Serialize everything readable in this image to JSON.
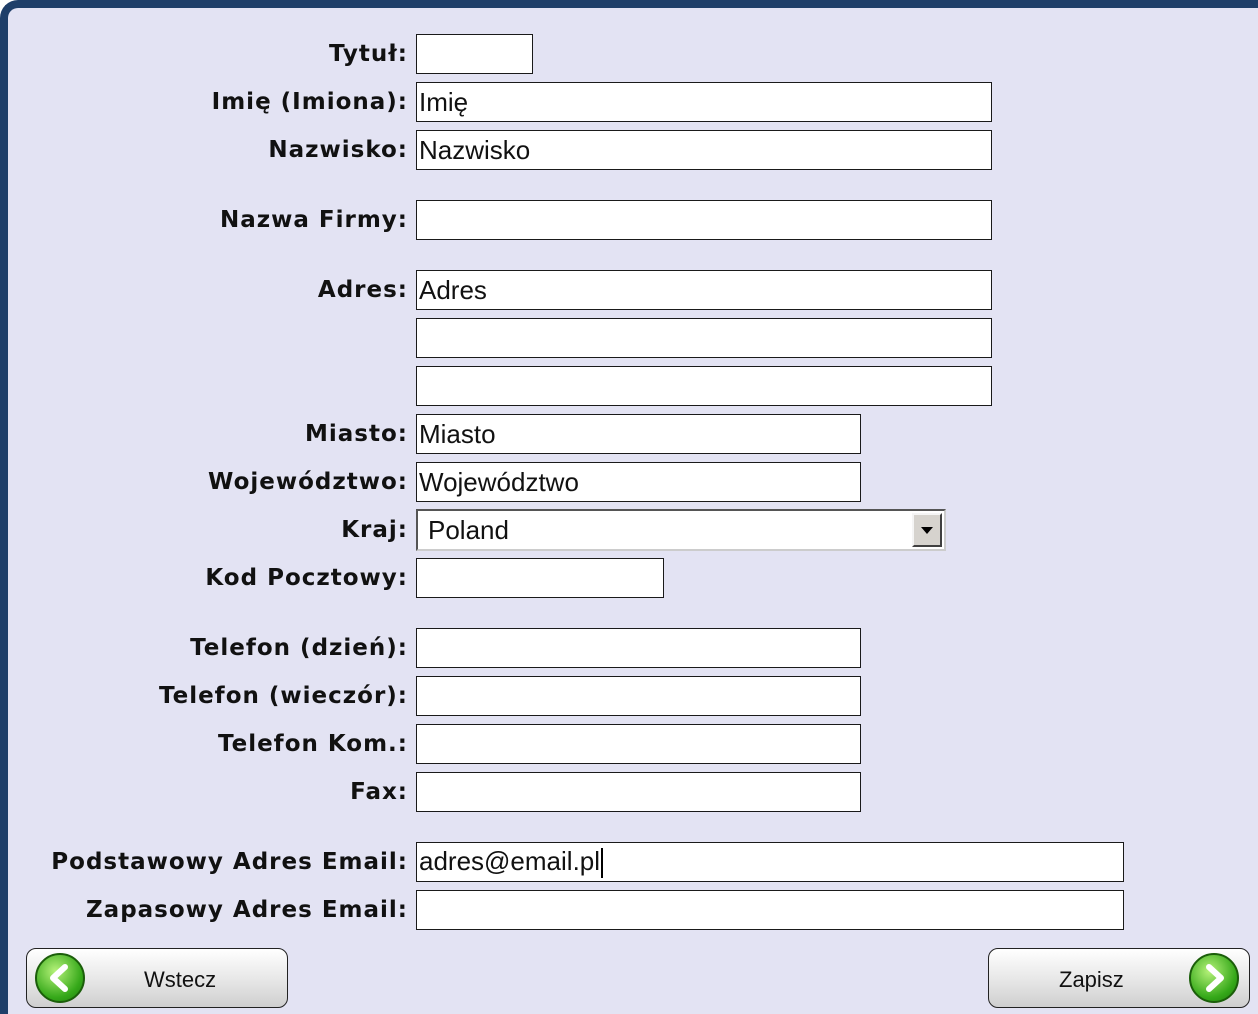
{
  "form": {
    "fields": {
      "title": {
        "label": "Tytuł:",
        "value": ""
      },
      "first_name": {
        "label": "Imię (Imiona):",
        "value": "Imię"
      },
      "last_name": {
        "label": "Nazwisko:",
        "value": "Nazwisko"
      },
      "company": {
        "label": "Nazwa Firmy:",
        "value": ""
      },
      "address": {
        "label": "Adres:",
        "line1": "Adres",
        "line2": "",
        "line3": ""
      },
      "city": {
        "label": "Miasto:",
        "value": "Miasto"
      },
      "province": {
        "label": "Województwo:",
        "value": "Województwo"
      },
      "country": {
        "label": "Kraj:",
        "selected": "Poland"
      },
      "postal_code": {
        "label": "Kod Pocztowy:",
        "value": ""
      },
      "phone_day": {
        "label": "Telefon (dzień):",
        "value": ""
      },
      "phone_evening": {
        "label": "Telefon (wieczór):",
        "value": ""
      },
      "phone_mobile": {
        "label": "Telefon Kom.:",
        "value": ""
      },
      "fax": {
        "label": "Fax:",
        "value": ""
      },
      "email_primary": {
        "label": "Podstawowy Adres Email:",
        "value": "adres@email.pl"
      },
      "email_backup": {
        "label": "Zapasowy Adres Email:",
        "value": ""
      }
    }
  },
  "buttons": {
    "back_label": "Wstecz",
    "save_label": "Zapisz"
  },
  "icons": {
    "back": "arrow-left-circle-icon",
    "save": "arrow-right-circle-icon"
  },
  "colors": {
    "panel_background": "#e3e3f3",
    "panel_border": "#1f3f69",
    "icon_green": "#35a819"
  }
}
